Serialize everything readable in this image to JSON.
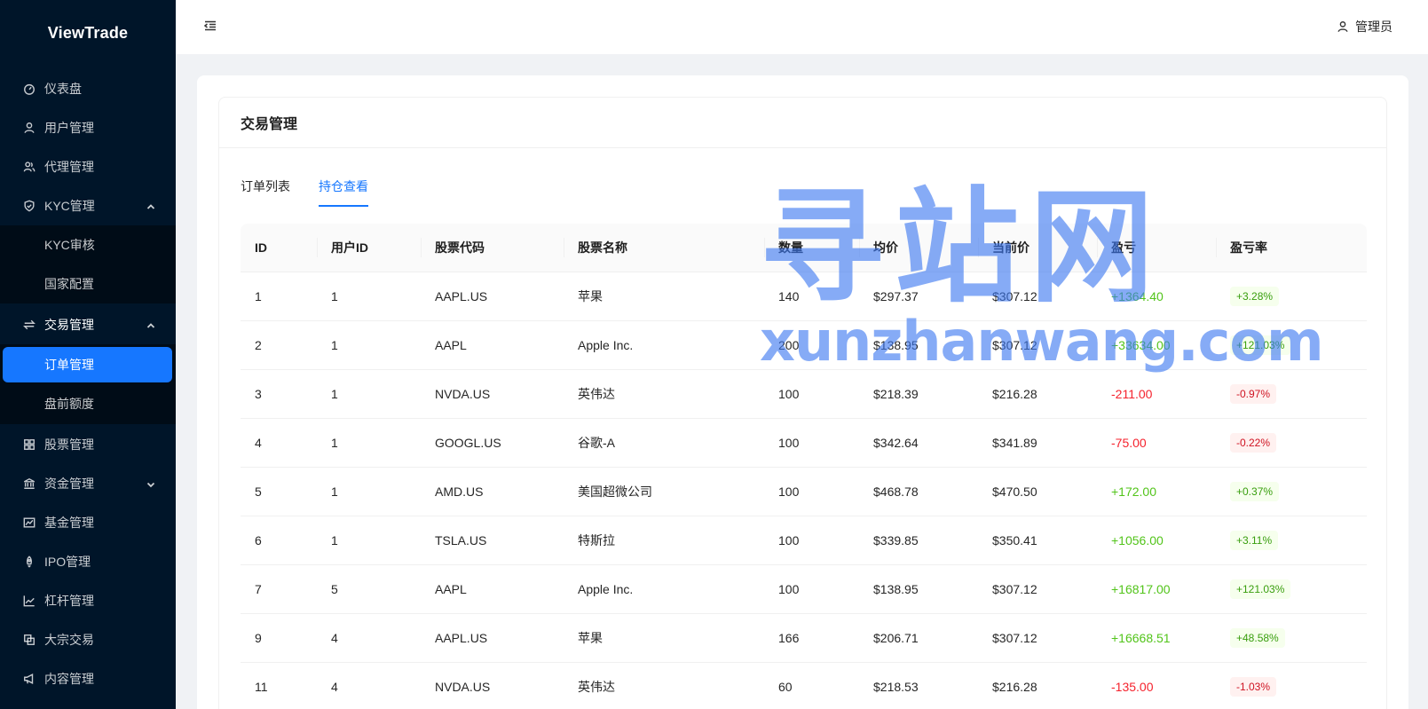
{
  "app": {
    "name": "ViewTrade"
  },
  "sidebar": {
    "items": [
      {
        "label": "仪表盘",
        "icon": "dashboard-icon"
      },
      {
        "label": "用户管理",
        "icon": "user-icon"
      },
      {
        "label": "代理管理",
        "icon": "agent-icon"
      },
      {
        "label": "KYC管理",
        "icon": "shield-icon",
        "expanded": true,
        "children": [
          {
            "label": "KYC审核"
          },
          {
            "label": "国家配置"
          }
        ]
      },
      {
        "label": "交易管理",
        "icon": "swap-icon",
        "expanded": true,
        "children": [
          {
            "label": "订单管理",
            "selected": true
          },
          {
            "label": "盘前额度"
          }
        ]
      },
      {
        "label": "股票管理",
        "icon": "appstore-icon"
      },
      {
        "label": "资金管理",
        "icon": "bank-icon",
        "expanded": false
      },
      {
        "label": "基金管理",
        "icon": "fund-icon"
      },
      {
        "label": "IPO管理",
        "icon": "rocket-icon"
      },
      {
        "label": "杠杆管理",
        "icon": "line-chart-icon"
      },
      {
        "label": "大宗交易",
        "icon": "block-icon"
      },
      {
        "label": "内容管理",
        "icon": "notification-icon"
      }
    ]
  },
  "header": {
    "user_label": "管理员"
  },
  "card": {
    "title": "交易管理"
  },
  "tabs": [
    {
      "label": "订单列表",
      "active": false
    },
    {
      "label": "持仓查看",
      "active": true
    }
  ],
  "table": {
    "columns": [
      "ID",
      "用户ID",
      "股票代码",
      "股票名称",
      "数量",
      "均价",
      "当前价",
      "盈亏",
      "盈亏率"
    ],
    "rows": [
      [
        "1",
        "1",
        "AAPL.US",
        "苹果",
        "140",
        "$297.37",
        "$307.12",
        "+1364.40",
        "+3.28%"
      ],
      [
        "2",
        "1",
        "AAPL",
        "Apple Inc.",
        "200",
        "$138.95",
        "$307.12",
        "+33634.00",
        "+121.03%"
      ],
      [
        "3",
        "1",
        "NVDA.US",
        "英伟达",
        "100",
        "$218.39",
        "$216.28",
        "-211.00",
        "-0.97%"
      ],
      [
        "4",
        "1",
        "GOOGL.US",
        "谷歌-A",
        "100",
        "$342.64",
        "$341.89",
        "-75.00",
        "-0.22%"
      ],
      [
        "5",
        "1",
        "AMD.US",
        "美国超微公司",
        "100",
        "$468.78",
        "$470.50",
        "+172.00",
        "+0.37%"
      ],
      [
        "6",
        "1",
        "TSLA.US",
        "特斯拉",
        "100",
        "$339.85",
        "$350.41",
        "+1056.00",
        "+3.11%"
      ],
      [
        "7",
        "5",
        "AAPL",
        "Apple Inc.",
        "100",
        "$138.95",
        "$307.12",
        "+16817.00",
        "+121.03%"
      ],
      [
        "9",
        "4",
        "AAPL.US",
        "苹果",
        "166",
        "$206.71",
        "$307.12",
        "+16668.51",
        "+48.58%"
      ],
      [
        "11",
        "4",
        "NVDA.US",
        "英伟达",
        "60",
        "$218.53",
        "$216.28",
        "-135.00",
        "-1.03%"
      ]
    ]
  },
  "watermark": {
    "big": "寻站网",
    "small": "xunzhanwang.com"
  },
  "colors": {
    "sidebar_bg": "#001529",
    "accent": "#1677ff",
    "profit": "#52c41a",
    "loss": "#f5222d"
  }
}
